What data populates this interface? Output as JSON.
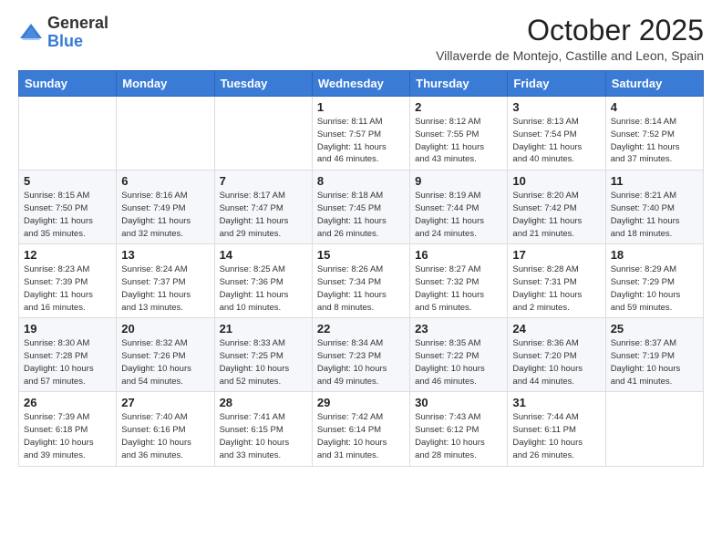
{
  "logo": {
    "general": "General",
    "blue": "Blue"
  },
  "header": {
    "month": "October 2025",
    "subtitle": "Villaverde de Montejo, Castille and Leon, Spain"
  },
  "weekdays": [
    "Sunday",
    "Monday",
    "Tuesday",
    "Wednesday",
    "Thursday",
    "Friday",
    "Saturday"
  ],
  "weeks": [
    [
      {
        "day": "",
        "info": ""
      },
      {
        "day": "",
        "info": ""
      },
      {
        "day": "",
        "info": ""
      },
      {
        "day": "1",
        "info": "Sunrise: 8:11 AM\nSunset: 7:57 PM\nDaylight: 11 hours\nand 46 minutes."
      },
      {
        "day": "2",
        "info": "Sunrise: 8:12 AM\nSunset: 7:55 PM\nDaylight: 11 hours\nand 43 minutes."
      },
      {
        "day": "3",
        "info": "Sunrise: 8:13 AM\nSunset: 7:54 PM\nDaylight: 11 hours\nand 40 minutes."
      },
      {
        "day": "4",
        "info": "Sunrise: 8:14 AM\nSunset: 7:52 PM\nDaylight: 11 hours\nand 37 minutes."
      }
    ],
    [
      {
        "day": "5",
        "info": "Sunrise: 8:15 AM\nSunset: 7:50 PM\nDaylight: 11 hours\nand 35 minutes."
      },
      {
        "day": "6",
        "info": "Sunrise: 8:16 AM\nSunset: 7:49 PM\nDaylight: 11 hours\nand 32 minutes."
      },
      {
        "day": "7",
        "info": "Sunrise: 8:17 AM\nSunset: 7:47 PM\nDaylight: 11 hours\nand 29 minutes."
      },
      {
        "day": "8",
        "info": "Sunrise: 8:18 AM\nSunset: 7:45 PM\nDaylight: 11 hours\nand 26 minutes."
      },
      {
        "day": "9",
        "info": "Sunrise: 8:19 AM\nSunset: 7:44 PM\nDaylight: 11 hours\nand 24 minutes."
      },
      {
        "day": "10",
        "info": "Sunrise: 8:20 AM\nSunset: 7:42 PM\nDaylight: 11 hours\nand 21 minutes."
      },
      {
        "day": "11",
        "info": "Sunrise: 8:21 AM\nSunset: 7:40 PM\nDaylight: 11 hours\nand 18 minutes."
      }
    ],
    [
      {
        "day": "12",
        "info": "Sunrise: 8:23 AM\nSunset: 7:39 PM\nDaylight: 11 hours\nand 16 minutes."
      },
      {
        "day": "13",
        "info": "Sunrise: 8:24 AM\nSunset: 7:37 PM\nDaylight: 11 hours\nand 13 minutes."
      },
      {
        "day": "14",
        "info": "Sunrise: 8:25 AM\nSunset: 7:36 PM\nDaylight: 11 hours\nand 10 minutes."
      },
      {
        "day": "15",
        "info": "Sunrise: 8:26 AM\nSunset: 7:34 PM\nDaylight: 11 hours\nand 8 minutes."
      },
      {
        "day": "16",
        "info": "Sunrise: 8:27 AM\nSunset: 7:32 PM\nDaylight: 11 hours\nand 5 minutes."
      },
      {
        "day": "17",
        "info": "Sunrise: 8:28 AM\nSunset: 7:31 PM\nDaylight: 11 hours\nand 2 minutes."
      },
      {
        "day": "18",
        "info": "Sunrise: 8:29 AM\nSunset: 7:29 PM\nDaylight: 10 hours\nand 59 minutes."
      }
    ],
    [
      {
        "day": "19",
        "info": "Sunrise: 8:30 AM\nSunset: 7:28 PM\nDaylight: 10 hours\nand 57 minutes."
      },
      {
        "day": "20",
        "info": "Sunrise: 8:32 AM\nSunset: 7:26 PM\nDaylight: 10 hours\nand 54 minutes."
      },
      {
        "day": "21",
        "info": "Sunrise: 8:33 AM\nSunset: 7:25 PM\nDaylight: 10 hours\nand 52 minutes."
      },
      {
        "day": "22",
        "info": "Sunrise: 8:34 AM\nSunset: 7:23 PM\nDaylight: 10 hours\nand 49 minutes."
      },
      {
        "day": "23",
        "info": "Sunrise: 8:35 AM\nSunset: 7:22 PM\nDaylight: 10 hours\nand 46 minutes."
      },
      {
        "day": "24",
        "info": "Sunrise: 8:36 AM\nSunset: 7:20 PM\nDaylight: 10 hours\nand 44 minutes."
      },
      {
        "day": "25",
        "info": "Sunrise: 8:37 AM\nSunset: 7:19 PM\nDaylight: 10 hours\nand 41 minutes."
      }
    ],
    [
      {
        "day": "26",
        "info": "Sunrise: 7:39 AM\nSunset: 6:18 PM\nDaylight: 10 hours\nand 39 minutes."
      },
      {
        "day": "27",
        "info": "Sunrise: 7:40 AM\nSunset: 6:16 PM\nDaylight: 10 hours\nand 36 minutes."
      },
      {
        "day": "28",
        "info": "Sunrise: 7:41 AM\nSunset: 6:15 PM\nDaylight: 10 hours\nand 33 minutes."
      },
      {
        "day": "29",
        "info": "Sunrise: 7:42 AM\nSunset: 6:14 PM\nDaylight: 10 hours\nand 31 minutes."
      },
      {
        "day": "30",
        "info": "Sunrise: 7:43 AM\nSunset: 6:12 PM\nDaylight: 10 hours\nand 28 minutes."
      },
      {
        "day": "31",
        "info": "Sunrise: 7:44 AM\nSunset: 6:11 PM\nDaylight: 10 hours\nand 26 minutes."
      },
      {
        "day": "",
        "info": ""
      }
    ]
  ]
}
